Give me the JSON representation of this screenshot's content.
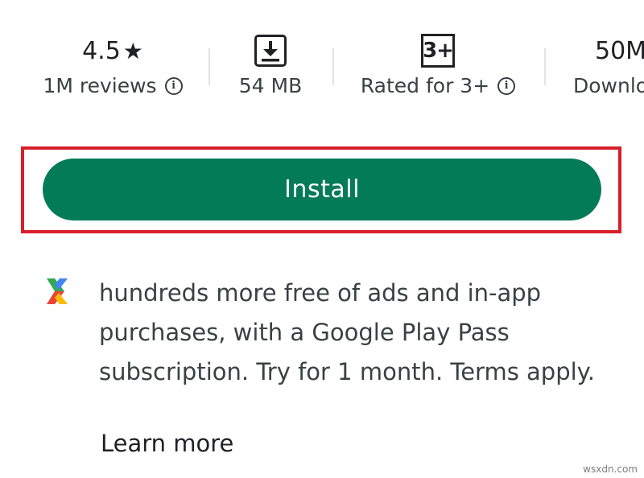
{
  "stats": [
    {
      "id": "rating",
      "value": "4.5",
      "icon": "star-icon",
      "label": "1M reviews",
      "info": true
    },
    {
      "id": "size",
      "icon": "download-box-icon",
      "label": "54 MB",
      "info": false
    },
    {
      "id": "content-rating",
      "badge": "3+",
      "label": "Rated for 3+",
      "info": true
    },
    {
      "id": "downloads",
      "value": "50M",
      "label": "Downlo",
      "info": false
    }
  ],
  "install": {
    "label": "Install"
  },
  "promo": {
    "icon": "play-pass-icon",
    "text": "hundreds more free of ads and in-app purchases, with a Google Play Pass subscription. Try for 1 month. Terms apply.",
    "link": "Learn more"
  },
  "watermark": "wsxdn.com",
  "colors": {
    "install": "#047b57",
    "highlight": "#d81f2a",
    "text_primary": "#202124",
    "text_secondary": "#3c4043"
  }
}
